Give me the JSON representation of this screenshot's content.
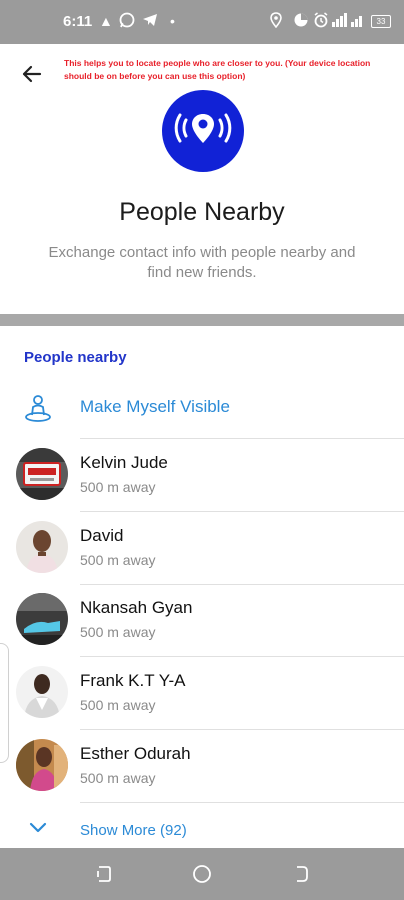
{
  "status_bar": {
    "time": "6:11",
    "left_icons": [
      "warning-icon",
      "whatsapp-icon",
      "telegram-icon",
      "dot-icon"
    ],
    "right_icons": [
      "location-icon",
      "data-saver-icon",
      "alarm-icon",
      "signal-icon"
    ],
    "battery": "33"
  },
  "header": {
    "notice": "This helps you to locate people who are closer to you. (Your device location should be on before you can use this option)",
    "title": "People Nearby",
    "subtitle": "Exchange contact info with people nearby and find new friends."
  },
  "list": {
    "section_title": "People nearby",
    "make_visible_label": "Make Myself Visible",
    "people": [
      {
        "name": "Kelvin Jude",
        "distance": "500 m away"
      },
      {
        "name": "David",
        "distance": "500 m away"
      },
      {
        "name": "Nkansah Gyan",
        "distance": "500 m away"
      },
      {
        "name": "Frank K.T Y-A",
        "distance": "500 m away"
      },
      {
        "name": "Esther Odurah",
        "distance": "500 m away"
      }
    ],
    "show_more_label": "Show More (92)"
  },
  "colors": {
    "accent_blue": "#2b8ad6",
    "section_blue": "#2235c9",
    "location_circle": "#1122d6",
    "notice_red": "#e8202a",
    "bars_gray": "#9b9b9b"
  }
}
